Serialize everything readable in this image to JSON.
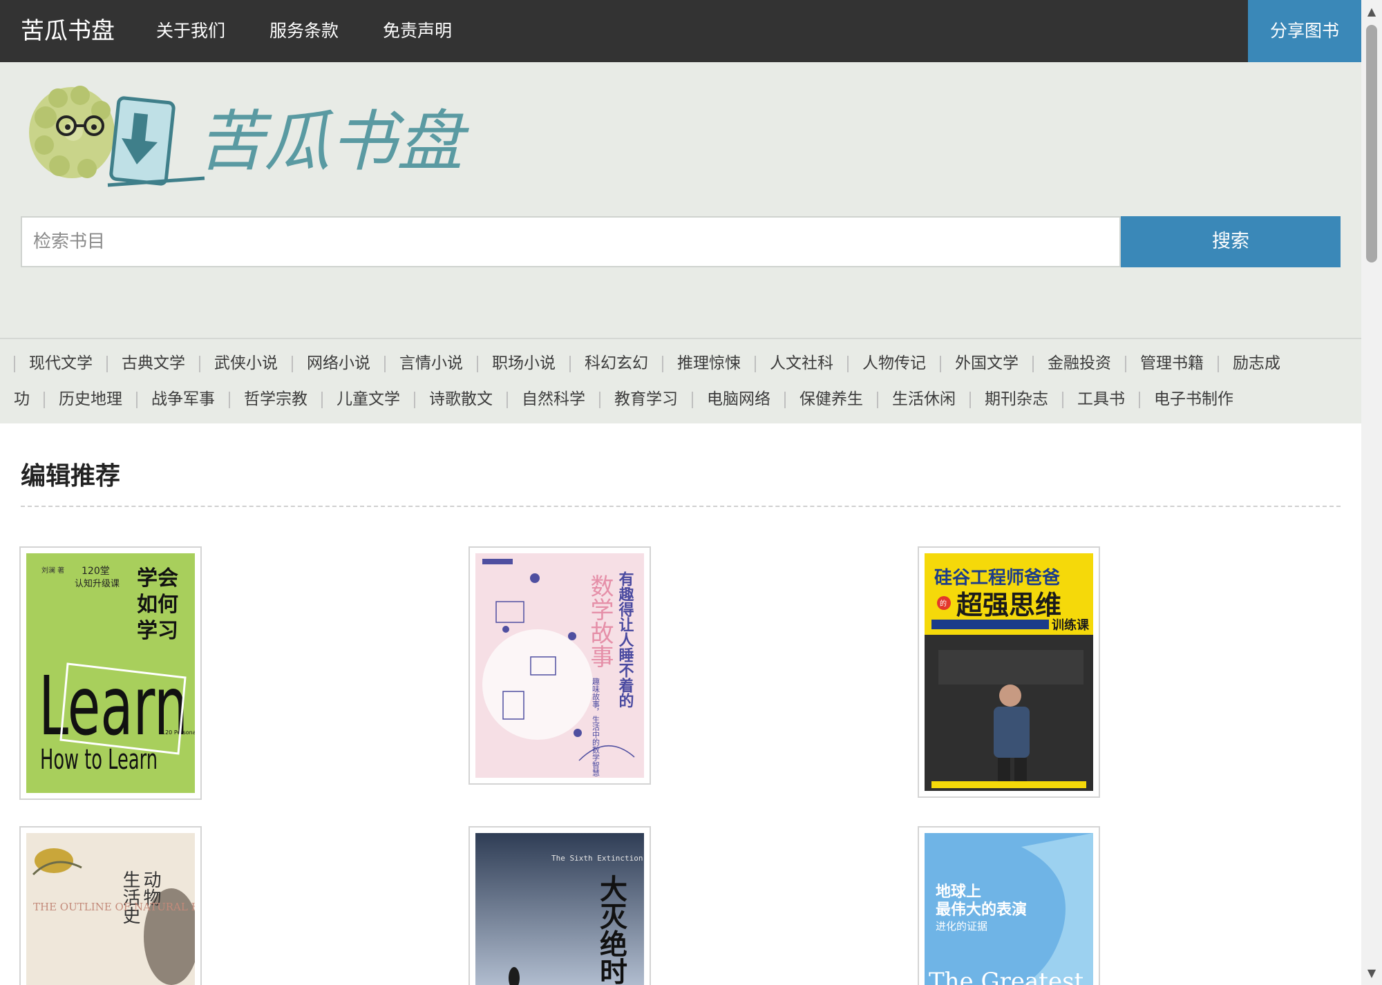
{
  "nav": {
    "brand": "苦瓜书盘",
    "links": [
      "关于我们",
      "服务条款",
      "免责声明"
    ],
    "share": "分享图书"
  },
  "header": {
    "logo_text": "苦瓜书盘",
    "search_placeholder": "检索书目",
    "search_button": "搜索"
  },
  "categories": {
    "row1": [
      "现代文学",
      "古典文学",
      "武侠小说",
      "网络小说",
      "言情小说",
      "职场小说",
      "科幻玄幻",
      "推理惊悚",
      "人文社科",
      "人物传记",
      "外国文学",
      "金融投资",
      "管理书籍",
      "励志成"
    ],
    "row2": [
      "功",
      "历史地理",
      "战争军事",
      "哲学宗教",
      "儿童文学",
      "诗歌散文",
      "自然科学",
      "教育学习",
      "电脑网络",
      "保健养生",
      "生活休闲",
      "期刊杂志",
      "工具书",
      "电子书制作"
    ]
  },
  "section": {
    "title": "编辑推荐"
  },
  "books": [
    {
      "title": "学会如何学习",
      "cover_lines": [
        "刘澜 著",
        "120堂",
        "认知升级课",
        "学会",
        "如何",
        "学习",
        "Learn",
        "How to Learn",
        "120 Personal Lessons with Liu Lan"
      ],
      "color": "#a8cf5c"
    },
    {
      "title": "数学故事",
      "cover_lines": [
        "有趣得让人睡不着的",
        "数学故事",
        "趣味故事，生活中的数学智慧"
      ],
      "color": "#f6dfe5"
    },
    {
      "title": "硅谷工程师爸爸的超强思维训练课",
      "cover_lines": [
        "硅谷工程师爸爸",
        "的",
        "超强思维",
        "训练课"
      ],
      "color": "#2f2f2f"
    },
    {
      "title": "动物生活史",
      "cover_lines": [
        "动物",
        "生活史",
        "THE OUTLINE OF NATURAL HISTORY"
      ],
      "color": "#efe7da"
    },
    {
      "title": "大灭绝时代",
      "cover_lines": [
        "The Sixth Extinction",
        "大灭绝时代"
      ],
      "color": "#8ea0b3"
    },
    {
      "title": "地球上最伟大的表演",
      "cover_lines": [
        "地球上",
        "最伟大的表演",
        "进化的证据",
        "The Greatest"
      ],
      "color": "#6fb4e6"
    }
  ]
}
